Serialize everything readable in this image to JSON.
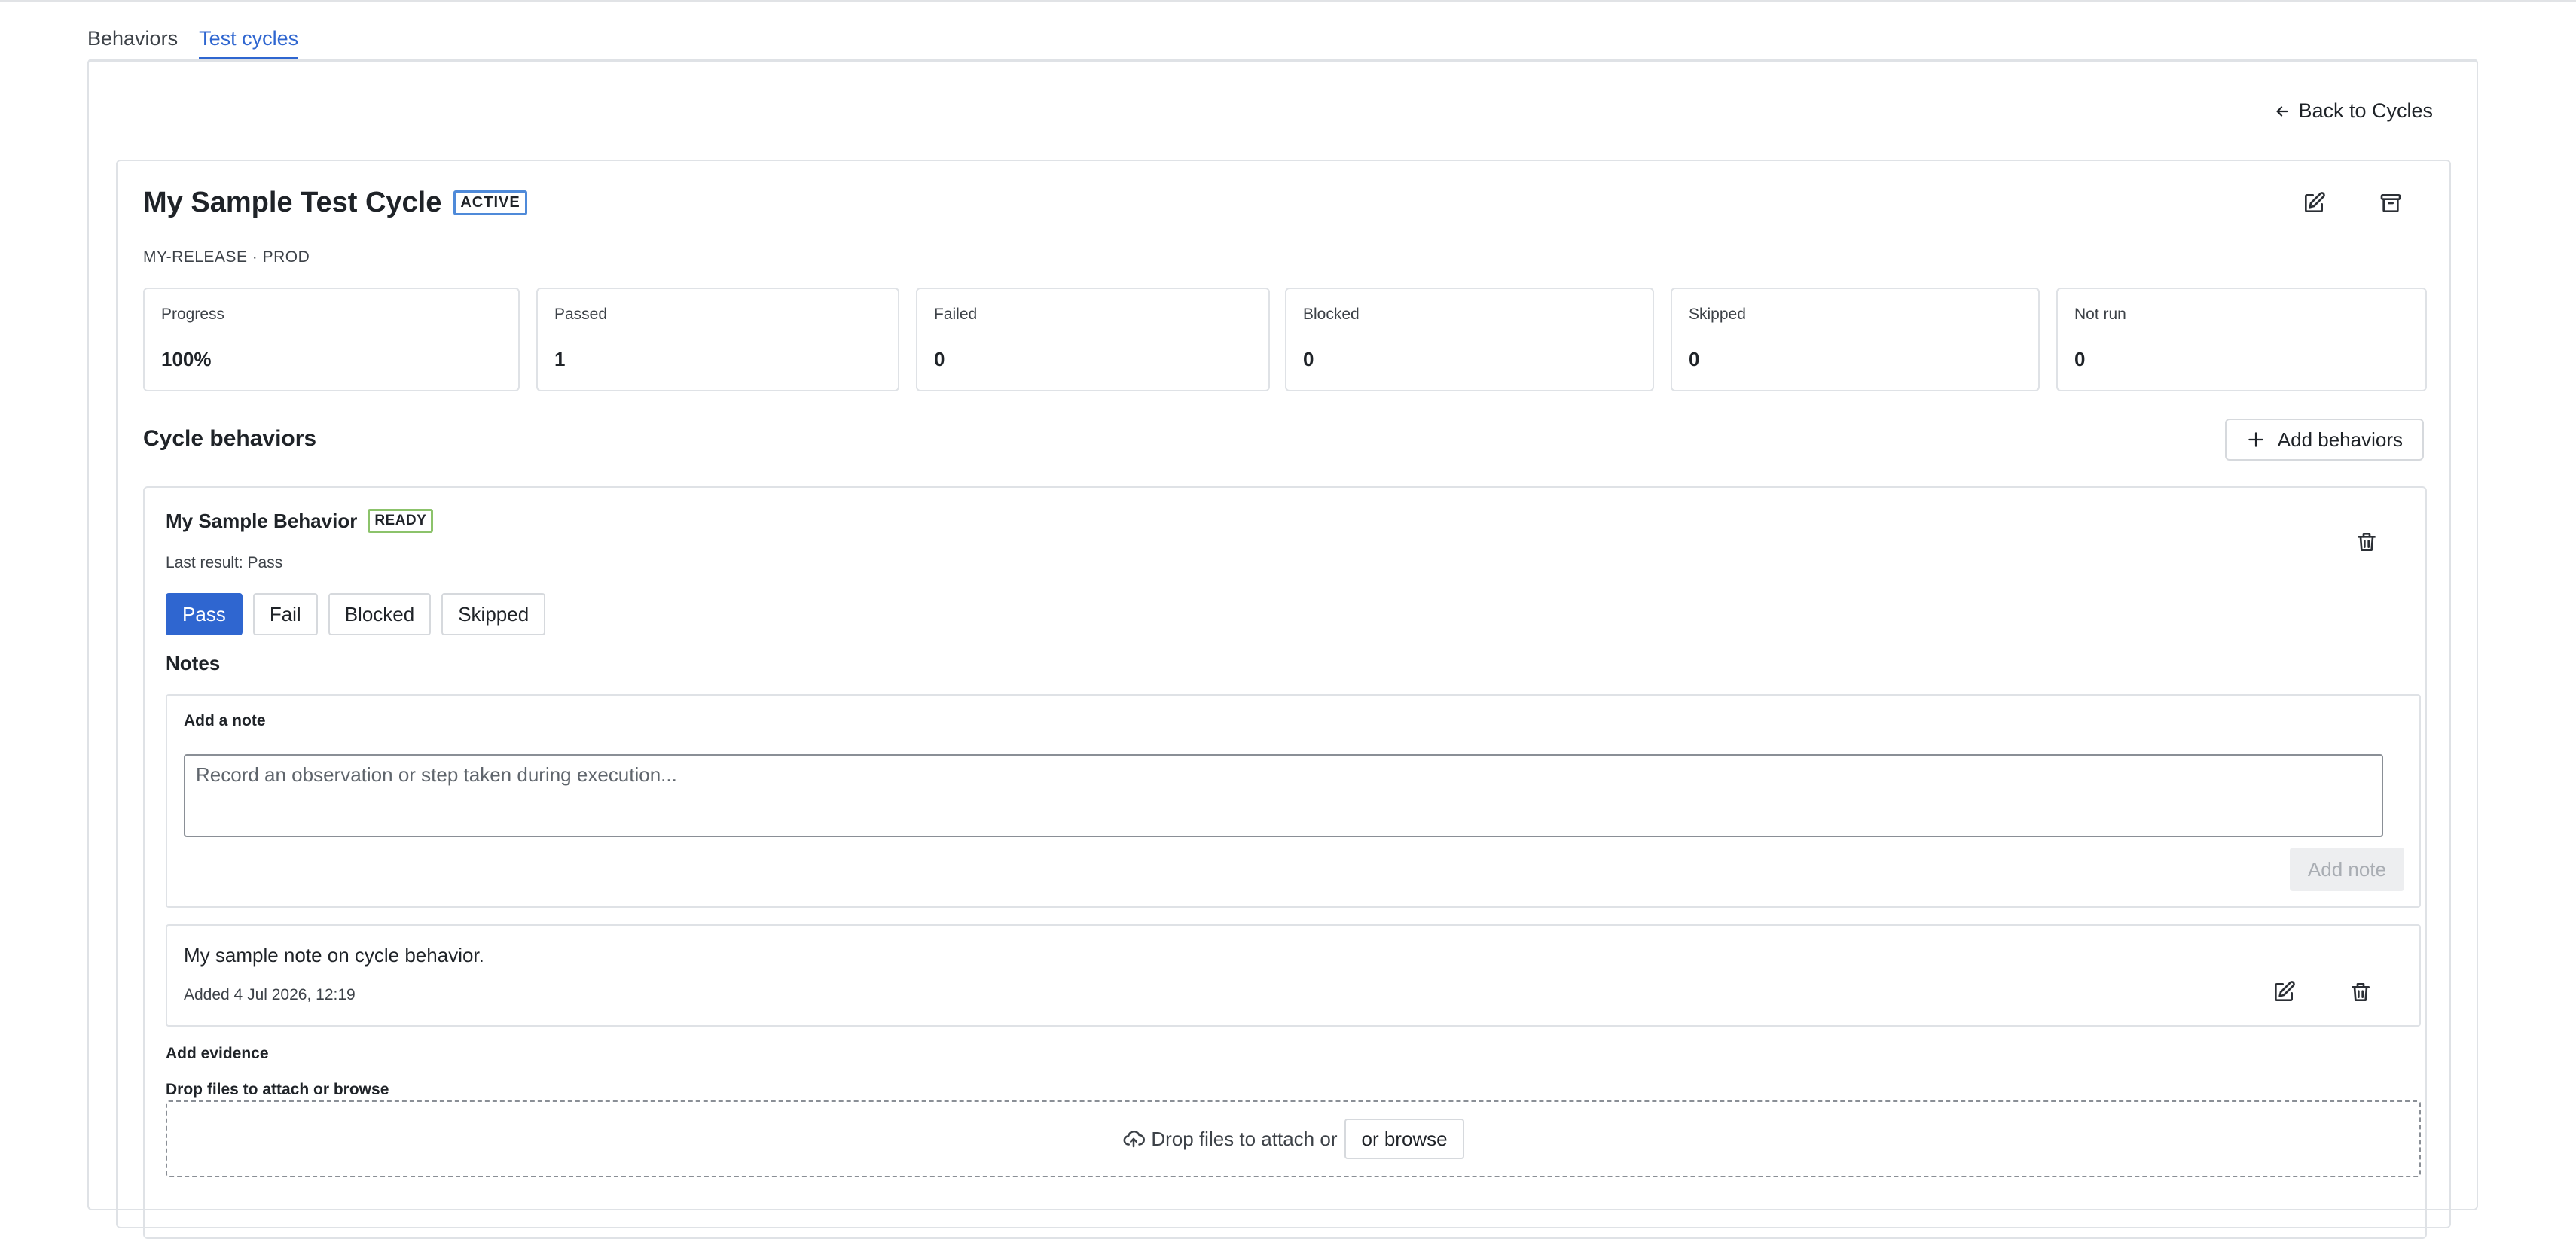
{
  "tabs": [
    {
      "label": "Behaviors",
      "active": false
    },
    {
      "label": "Test cycles",
      "active": true
    }
  ],
  "back_link": {
    "label": "Back to Cycles",
    "icon": "arrow-left-icon"
  },
  "cycle": {
    "title": "My Sample Test Cycle",
    "status": "ACTIVE",
    "meta": "MY-RELEASE · PROD",
    "edit_icon": "edit-icon",
    "archive_icon": "archive-icon"
  },
  "stats": [
    {
      "label": "Progress",
      "value": "100%"
    },
    {
      "label": "Passed",
      "value": "1"
    },
    {
      "label": "Failed",
      "value": "0"
    },
    {
      "label": "Blocked",
      "value": "0"
    },
    {
      "label": "Skipped",
      "value": "0"
    },
    {
      "label": "Not run",
      "value": "0"
    }
  ],
  "cycle_behaviors": {
    "title": "Cycle behaviors",
    "add_button": "Add behaviors"
  },
  "behavior": {
    "title": "My Sample Behavior",
    "status": "READY",
    "last_result": "Last result: Pass",
    "result_buttons": [
      "Pass",
      "Fail",
      "Blocked",
      "Skipped"
    ],
    "selected_result": "Pass",
    "notes_title": "Notes",
    "add_note_label": "Add a note",
    "note_placeholder": "Record an observation or step taken during execution...",
    "add_note_button": "Add note",
    "existing_note": {
      "text": "My sample note on cycle behavior.",
      "date": "Added 4 Jul 2026, 12:19"
    },
    "evidence_title": "Add evidence",
    "drop_label": "Drop files to attach or browse",
    "drop_text": "Drop files to attach or",
    "browse_button": "or browse"
  },
  "colors": {
    "accent": "#2f66d0",
    "active_badge_border": "#4f8ad9",
    "ready_badge_border": "#8cc36b",
    "border": "#dfe2e6"
  }
}
